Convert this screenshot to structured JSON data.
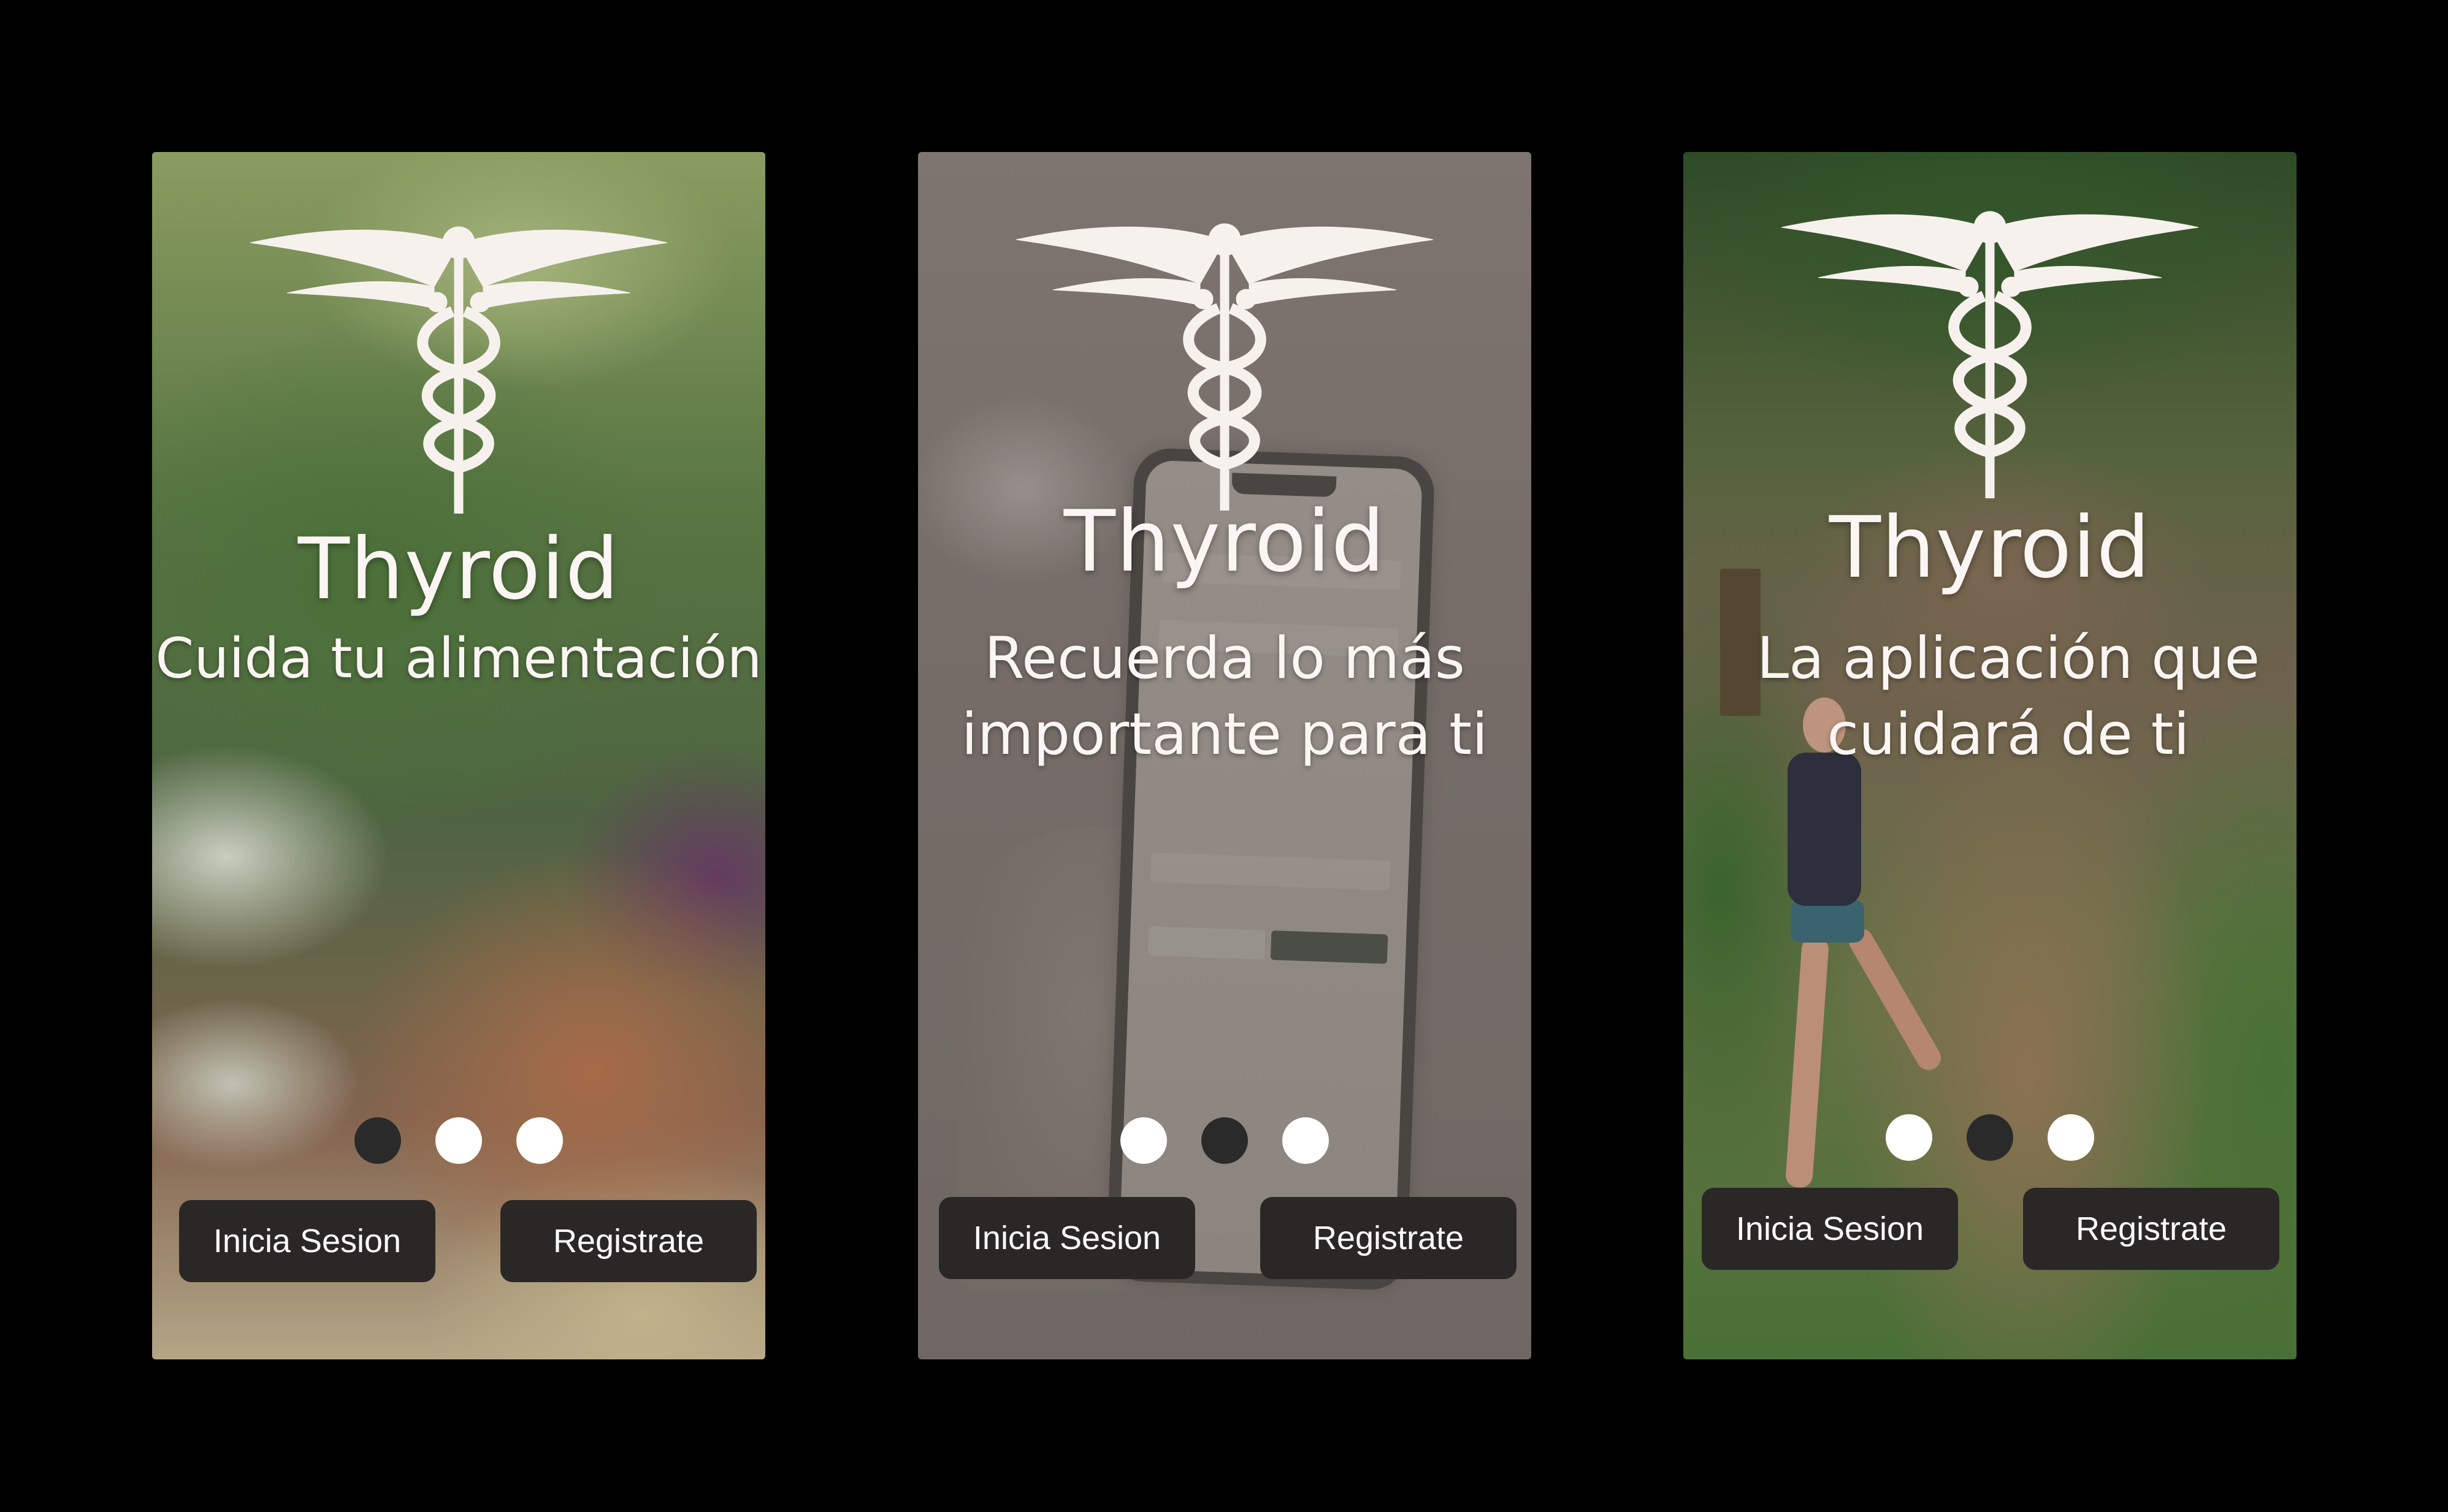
{
  "screens": [
    {
      "brand": "Thyroid",
      "tagline_line1": "Cuida tu alimentación",
      "tagline_line2": "",
      "active_dot": 0,
      "login_label": "Inicia Sesion",
      "register_label": "Registrate"
    },
    {
      "brand": "Thyroid",
      "tagline_line1": "Recuerda lo más",
      "tagline_line2": "importante para ti",
      "active_dot": 1,
      "login_label": "Inicia Sesion",
      "register_label": "Registrate"
    },
    {
      "brand": "Thyroid",
      "tagline_line1": "La aplicación que",
      "tagline_line2": "cuidará de ti",
      "active_dot": 1,
      "login_label": "Inicia Sesion",
      "register_label": "Registrate"
    }
  ],
  "icons": {
    "logo": "caduceus-icon"
  },
  "colors": {
    "background": "#000000",
    "button": "#2a2727",
    "dot_inactive": "#ffffff",
    "dot_active": "#2a2a2a",
    "text": "#fbf6f3"
  }
}
